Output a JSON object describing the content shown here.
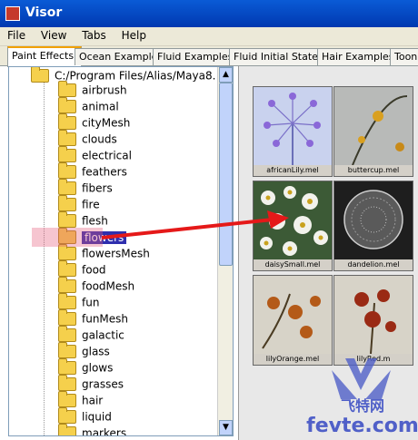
{
  "window": {
    "title": "Visor"
  },
  "menu": [
    "File",
    "View",
    "Tabs",
    "Help"
  ],
  "tabs": [
    "Paint Effects",
    "Ocean Examples",
    "Fluid Examples",
    "Fluid Initial States",
    "Hair Examples",
    "Toon"
  ],
  "tree": {
    "root": "C:/Program Files/Alias/Maya8.",
    "items": [
      "airbrush",
      "animal",
      "cityMesh",
      "clouds",
      "electrical",
      "feathers",
      "fibers",
      "fire",
      "flesh",
      "flowers",
      "flowersMesh",
      "food",
      "foodMesh",
      "fun",
      "funMesh",
      "galactic",
      "glass",
      "glows",
      "grasses",
      "hair",
      "liquid",
      "markers"
    ],
    "selected": "flowers"
  },
  "gallery": [
    {
      "label": "africanLily.mel"
    },
    {
      "label": "buttercup.mel"
    },
    {
      "label": "daisySmall.mel"
    },
    {
      "label": "dandelion.mel"
    },
    {
      "label": "lilyOrange.mel"
    },
    {
      "label": "lilyRed.m"
    }
  ],
  "watermark": {
    "line1": "飞特网",
    "line2": "fevte.com"
  }
}
